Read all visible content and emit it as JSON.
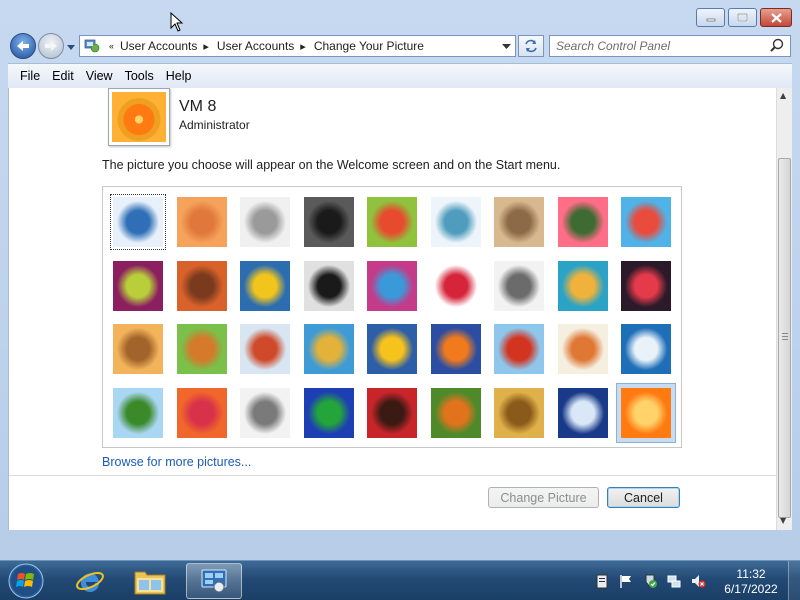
{
  "window": {
    "controls": [
      "minimize-icon",
      "maximize-icon",
      "close-icon"
    ]
  },
  "address": {
    "overflow": "«",
    "crumbs": [
      "User Accounts",
      "User Accounts",
      "Change Your Picture"
    ],
    "search_placeholder": "Search Control Panel"
  },
  "menu": {
    "items": [
      "File",
      "Edit",
      "View",
      "Tools",
      "Help"
    ]
  },
  "user": {
    "name": "VM 8",
    "role": "Administrator"
  },
  "instruction": "The picture you choose will appear on the Welcome screen and on the Start menu.",
  "pictures": [
    {
      "name": "roller-coaster",
      "c1": "#e8f1fb",
      "c2": "#2f6fb7"
    },
    {
      "name": "starfish",
      "c1": "#f5a25b",
      "c2": "#e0773b"
    },
    {
      "name": "robot-toy",
      "c1": "#f0f0f0",
      "c2": "#9a9a9a"
    },
    {
      "name": "record-player",
      "c1": "#5a5a5a",
      "c2": "#1a1a1a"
    },
    {
      "name": "lucky-cat",
      "c1": "#8fc23d",
      "c2": "#e84a2e"
    },
    {
      "name": "spinning-top",
      "c1": "#eef5fa",
      "c2": "#4f9cbe"
    },
    {
      "name": "kitten",
      "c1": "#d8b98f",
      "c2": "#8c6a48"
    },
    {
      "name": "pink-flower",
      "c1": "#ff6d86",
      "c2": "#3d6b32"
    },
    {
      "name": "pinwheel",
      "c1": "#4fb3e8",
      "c2": "#e94c3d"
    },
    {
      "name": "ball",
      "c1": "#8b1f5f",
      "c2": "#b8cf3a"
    },
    {
      "name": "woven-fabric",
      "c1": "#d9622b",
      "c2": "#7a3a1e"
    },
    {
      "name": "ginkgo-leaf",
      "c1": "#2c6db0",
      "c2": "#f2c51c"
    },
    {
      "name": "dog",
      "c1": "#e0e0e0",
      "c2": "#1a1a1a"
    },
    {
      "name": "crayons",
      "c1": "#c43b8a",
      "c2": "#3a9ad9"
    },
    {
      "name": "red-star",
      "c1": "#ffffff",
      "c2": "#d6243a"
    },
    {
      "name": "jacks",
      "c1": "#f2f2f2",
      "c2": "#6b6b6b"
    },
    {
      "name": "stairs",
      "c1": "#2ba3c6",
      "c2": "#f0b23a"
    },
    {
      "name": "origami-crane",
      "c1": "#2a1a2a",
      "c2": "#e43a4a"
    },
    {
      "name": "guitar",
      "c1": "#f2b35a",
      "c2": "#a2642a"
    },
    {
      "name": "pomeranian",
      "c1": "#7ac04a",
      "c2": "#d5792b"
    },
    {
      "name": "tin-robot",
      "c1": "#d7e6f2",
      "c2": "#cf4a2a"
    },
    {
      "name": "colorful-scarf",
      "c1": "#3f9bd6",
      "c2": "#e2b23a"
    },
    {
      "name": "sunflower",
      "c1": "#2d5ea8",
      "c2": "#f6c21c"
    },
    {
      "name": "fish",
      "c1": "#2b4ea3",
      "c2": "#f17a1d"
    },
    {
      "name": "hot-air-balloon",
      "c1": "#8fc6ec",
      "c2": "#d2341f"
    },
    {
      "name": "clay-figure",
      "c1": "#f5efe0",
      "c2": "#e07835"
    },
    {
      "name": "sailboat",
      "c1": "#1e6fb8",
      "c2": "#e9f2f8"
    },
    {
      "name": "soccer-ball",
      "c1": "#a9d6f2",
      "c2": "#3a8a2a"
    },
    {
      "name": "striped-fabric",
      "c1": "#f0662b",
      "c2": "#d8314a"
    },
    {
      "name": "marbles",
      "c1": "#f2f2f2",
      "c2": "#7a7a7a"
    },
    {
      "name": "green-window",
      "c1": "#1d3fb3",
      "c2": "#23a53a"
    },
    {
      "name": "woven-pattern",
      "c1": "#c8252b",
      "c2": "#3a1a12"
    },
    {
      "name": "butterfly",
      "c1": "#4e8a2a",
      "c2": "#e2731d"
    },
    {
      "name": "basket-weave",
      "c1": "#e0b14a",
      "c2": "#8a5a1a"
    },
    {
      "name": "lighthouse",
      "c1": "#183a88",
      "c2": "#d9e7f7"
    },
    {
      "name": "orange-flower",
      "c1": "#ff7a10",
      "c2": "#ffd36a"
    }
  ],
  "browse_link": "Browse for more pictures...",
  "buttons": {
    "change": "Change Picture",
    "cancel": "Cancel"
  },
  "taskbar": {
    "time": "11:32",
    "date": "6/17/2022"
  }
}
